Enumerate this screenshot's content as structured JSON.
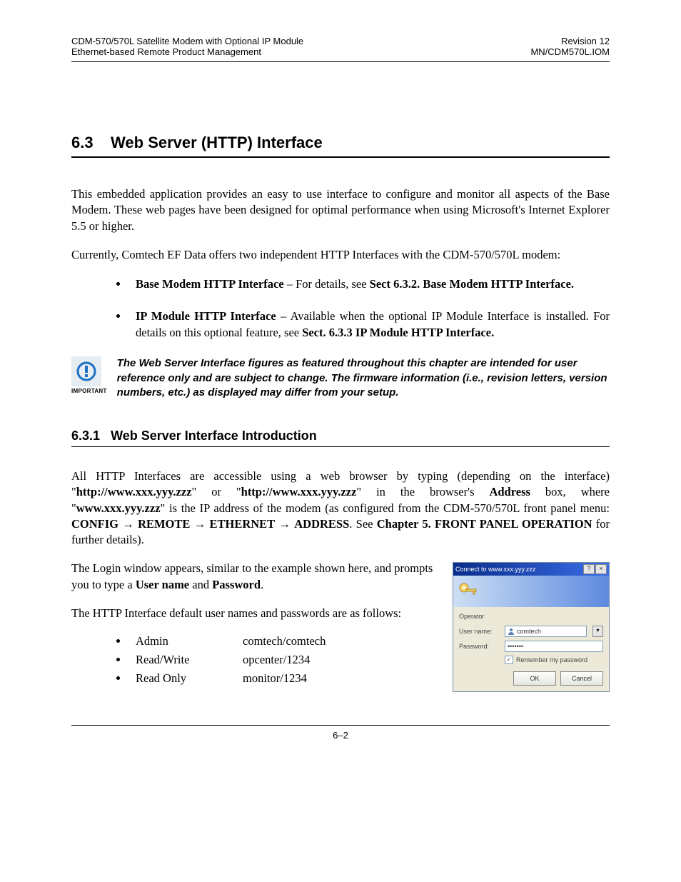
{
  "header": {
    "left1": "CDM-570/570L Satellite Modem with Optional IP Module",
    "left2": "Ethernet-based Remote Product Management",
    "right1": "Revision 12",
    "right2": "MN/CDM570L.IOM"
  },
  "section": {
    "number": "6.3",
    "title": "Web Server (HTTP) Interface"
  },
  "p1": "This embedded application provides an easy to use interface to configure and monitor all aspects of the Base Modem. These web pages have been designed for optimal performance when using Microsoft's Internet Explorer 5.5 or higher.",
  "p2": "Currently, Comtech EF Data offers two independent HTTP Interfaces with the CDM-570/570L modem:",
  "bullets": [
    {
      "bold1": "Base Modem HTTP Interface",
      "mid": " – For details, see ",
      "bold2": "Sect 6.3.2. Base Modem HTTP Interface."
    },
    {
      "bold1": "IP Module HTTP Interface",
      "mid": " – Available when the optional IP Module Interface is installed. For details on this optional feature, see ",
      "bold2": "Sect. 6.3.3 IP Module HTTP Interface."
    }
  ],
  "important_label": "IMPORTANT",
  "important_text": "The Web Server Interface figures as featured throughout this chapter are intended for user reference only and are subject to change. The firmware information (i.e., revision letters, version numbers, etc.) as displayed may differ from your setup.",
  "subsection": {
    "number": "6.3.1",
    "title": "Web Server Interface Introduction"
  },
  "p3_parts": {
    "pre": "All HTTP Interfaces are accessible using a web browser by typing (depending on the interface) \"",
    "url1": "http://www.xxx.yyy.zzz",
    "mid1": "\" or \"",
    "url2": "http://www.xxx.yyy.zzz",
    "mid2": "\" in the browser's ",
    "address": "Address",
    "mid3": " box, where \"",
    "ip": "www.xxx.yyy.zzz",
    "mid4": "\" is the IP address of the modem (as configured from the CDM-570/570L front panel menu: ",
    "m1": "CONFIG",
    "m2": "REMOTE",
    "m3": "ETHERNET",
    "m4": "ADDRESS",
    "dot": ". See ",
    "ref": "Chapter 5. FRONT PANEL OPERATION",
    "post": " for further details)."
  },
  "p4": {
    "pre": "The Login window appears, similar to the example shown here, and prompts you to type a ",
    "u1": "User name",
    "mid": " and ",
    "u2": "Password",
    "post": "."
  },
  "p5": "The HTTP Interface default user names and passwords are as follows:",
  "creds": [
    {
      "k": "Admin",
      "v": "comtech/comtech"
    },
    {
      "k": "Read/Write",
      "v": "opcenter/1234"
    },
    {
      "k": "Read Only",
      "v": "monitor/1234"
    }
  ],
  "login": {
    "title": "Connect to www.xxx.yyy.zzz",
    "operator": "Operator",
    "user_label": "User name:",
    "pass_label": "Password:",
    "user_value": "comtech",
    "pass_value": "•••••••",
    "remember": "Remember my password",
    "ok": "OK",
    "cancel": "Cancel"
  },
  "footer": "6–2"
}
